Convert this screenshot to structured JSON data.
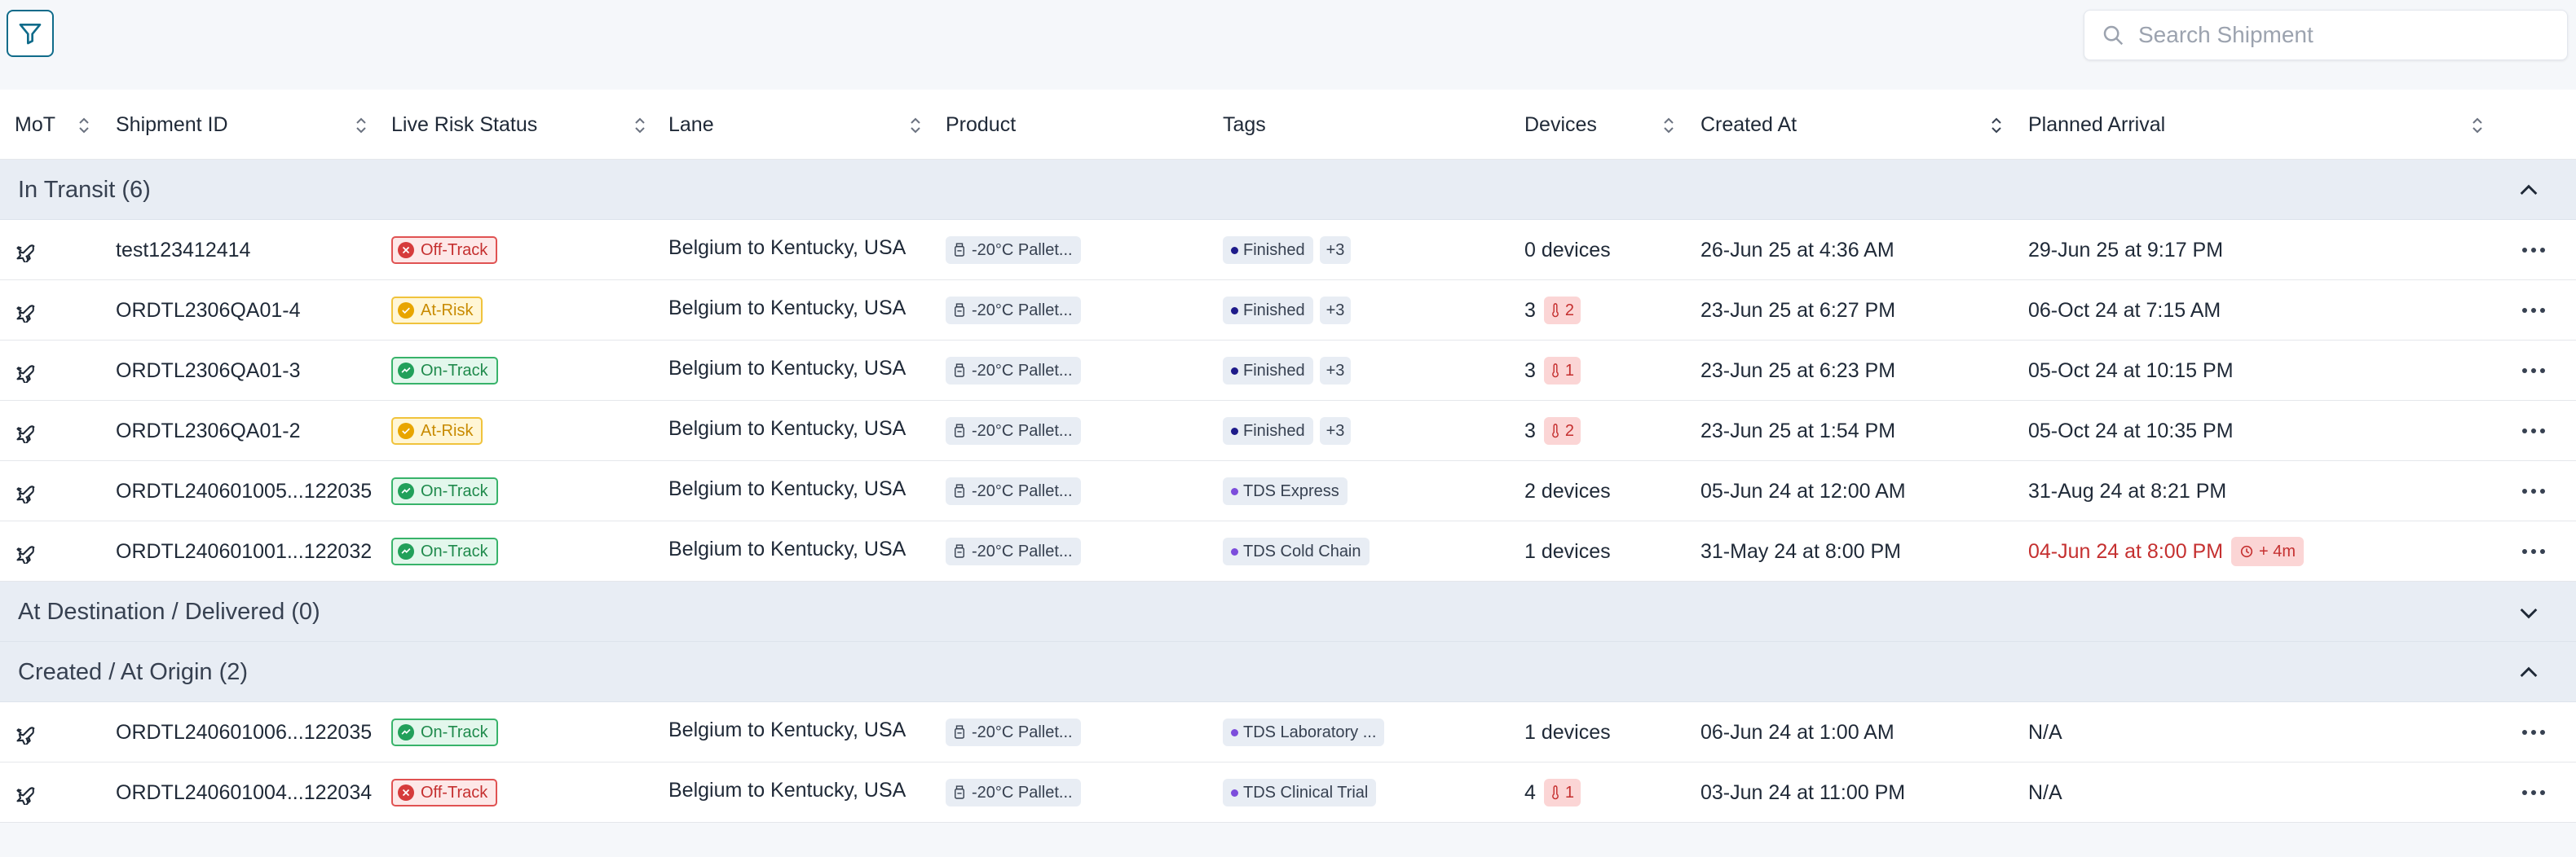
{
  "search": {
    "placeholder": "Search Shipment"
  },
  "columns": {
    "mot": "MoT",
    "shipment_id": "Shipment ID",
    "live_risk": "Live Risk Status",
    "lane": "Lane",
    "product": "Product",
    "tags": "Tags",
    "devices": "Devices",
    "created_at": "Created At",
    "planned_arrival": "Planned Arrival"
  },
  "groups": [
    {
      "label": "In Transit (6)",
      "expanded": true
    },
    {
      "label": "At Destination / Delivered (0)",
      "expanded": false
    },
    {
      "label": "Created / At Origin (2)",
      "expanded": true
    }
  ],
  "colors": {
    "off_track": "#d63b3b",
    "at_risk": "#e8a500",
    "on_track": "#22a05a",
    "late_text": "#c53030",
    "accent": "#0f6b8a"
  },
  "rows": [
    {
      "mot_icon": "plane-icon",
      "id": "test123412414",
      "status": "Off-Track",
      "lane": "Belgium to Kentucky, USA",
      "product": "-20°C Pallet...",
      "tag": "Finished",
      "tag_more": "+3",
      "devices": "0 devices",
      "alarms": "",
      "created": "26-Jun 25 at 4:36 AM",
      "arrival": "29-Jun 25 at 9:17 PM"
    },
    {
      "mot_icon": "plane-icon",
      "id": "ORDTL2306QA01-4",
      "status": "At-Risk",
      "lane": "Belgium to Kentucky, USA",
      "product": "-20°C Pallet...",
      "tag": "Finished",
      "tag_more": "+3",
      "devices": "3",
      "alarms": "2",
      "created": "23-Jun 25 at 6:27 PM",
      "arrival": "06-Oct 24 at 7:15 AM"
    },
    {
      "mot_icon": "plane-icon",
      "id": "ORDTL2306QA01-3",
      "status": "On-Track",
      "lane": "Belgium to Kentucky, USA",
      "product": "-20°C Pallet...",
      "tag": "Finished",
      "tag_more": "+3",
      "devices": "3",
      "alarms": "1",
      "created": "23-Jun 25 at 6:23 PM",
      "arrival": "05-Oct 24 at 10:15 PM"
    },
    {
      "mot_icon": "plane-icon",
      "id": "ORDTL2306QA01-2",
      "status": "At-Risk",
      "lane": "Belgium to Kentucky, USA",
      "product": "-20°C Pallet...",
      "tag": "Finished",
      "tag_more": "+3",
      "devices": "3",
      "alarms": "2",
      "created": "23-Jun 25 at 1:54 PM",
      "arrival": "05-Oct 24 at 10:35 PM"
    },
    {
      "mot_icon": "plane-icon",
      "id": "ORDTL240601005...122035",
      "status": "On-Track",
      "lane": "Belgium to Kentucky, USA",
      "product": "-20°C Pallet...",
      "tag": "TDS Express",
      "tag_more": "",
      "devices": "2 devices",
      "alarms": "",
      "created": "05-Jun 24 at 12:00 AM",
      "arrival": "31-Aug 24 at 8:21 PM"
    },
    {
      "mot_icon": "plane-icon",
      "id": "ORDTL240601001...122032",
      "status": "On-Track",
      "lane": "Belgium to Kentucky, USA",
      "product": "-20°C Pallet...",
      "tag": "TDS Cold Chain",
      "tag_more": "",
      "devices": "1 devices",
      "alarms": "",
      "created": "31-May 24 at 8:00 PM",
      "arrival": "04-Jun 24 at 8:00 PM",
      "arrival_delay": "+ 4m"
    },
    {
      "mot_icon": "plane-icon",
      "id": "ORDTL240601006...122035",
      "status": "On-Track",
      "lane": "Belgium to Kentucky, USA",
      "product": "-20°C Pallet...",
      "tag": "TDS Laboratory ...",
      "tag_more": "",
      "devices": "1 devices",
      "alarms": "",
      "created": "06-Jun 24 at 1:00 AM",
      "arrival": "N/A"
    },
    {
      "mot_icon": "plane-icon",
      "id": "ORDTL240601004...122034",
      "status": "Off-Track",
      "lane": "Belgium to Kentucky, USA",
      "product": "-20°C Pallet...",
      "tag": "TDS Clinical Trial",
      "tag_more": "",
      "devices": "4",
      "alarms": "1",
      "created": "03-Jun 24 at 11:00 PM",
      "arrival": "N/A"
    }
  ]
}
